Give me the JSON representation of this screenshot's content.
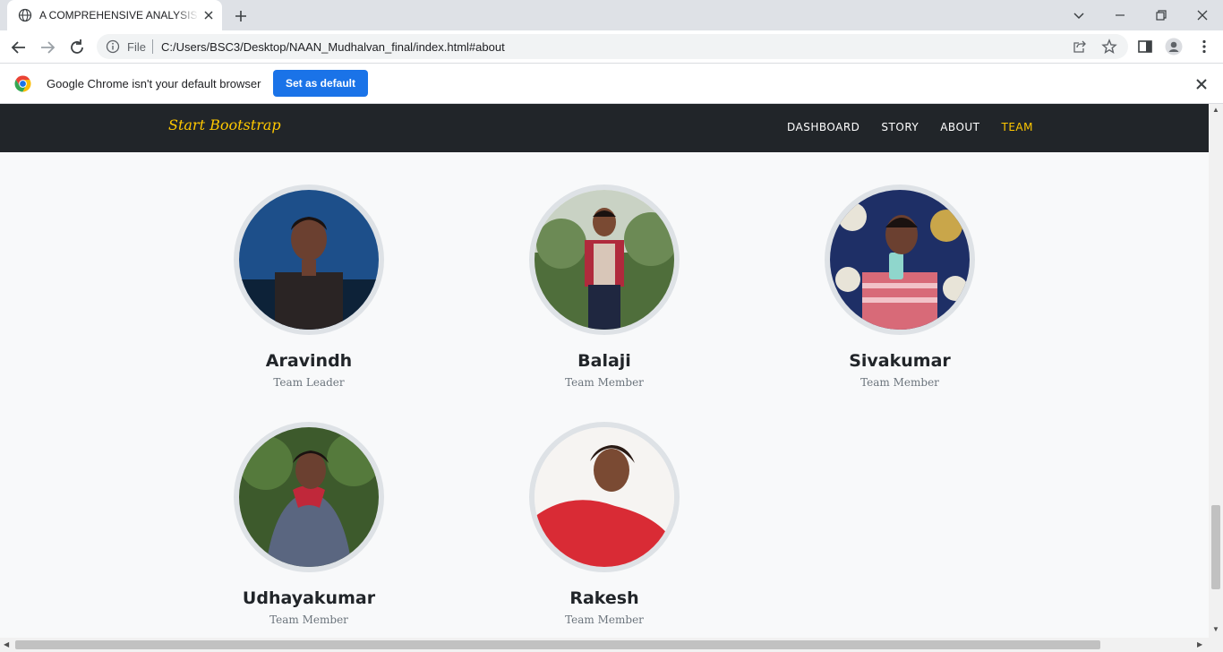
{
  "browser": {
    "tab_title": "A COMPREHENSIVE ANALYSIS OF",
    "scheme_label": "File",
    "url": "C:/Users/BSC3/Desktop/NAAN_Mudhalvan_final/index.html#about"
  },
  "infobar": {
    "message": "Google Chrome isn't your default browser",
    "button": "Set as default"
  },
  "site": {
    "brand": "Start Bootstrap",
    "nav": [
      "DASHBOARD",
      "STORY",
      "ABOUT",
      "TEAM"
    ],
    "active_nav": "TEAM",
    "accent_color": "#ffc800"
  },
  "team": [
    {
      "name": "Aravindh",
      "role": "Team Leader"
    },
    {
      "name": "Balaji",
      "role": "Team Member"
    },
    {
      "name": "Sivakumar",
      "role": "Team Member"
    },
    {
      "name": "Udhayakumar",
      "role": "Team Member"
    },
    {
      "name": "Rakesh",
      "role": "Team Member"
    }
  ]
}
